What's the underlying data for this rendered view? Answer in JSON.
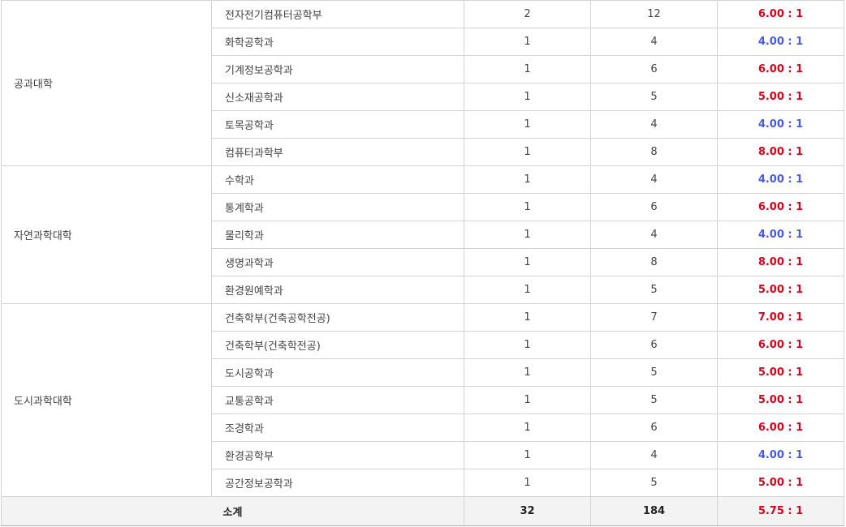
{
  "colors": {
    "ratio_high": "#e0001b",
    "ratio_low": "#4758e8",
    "border": "#d4d4d4",
    "total_bg": "#f3f3f3"
  },
  "groups": [
    {
      "college": "공과대학",
      "rows": [
        {
          "dept": "전자전기컴퓨터공학부",
          "quota": "2",
          "applicants": "12",
          "ratio": "6.00 : 1",
          "tone": "red"
        },
        {
          "dept": "화학공학과",
          "quota": "1",
          "applicants": "4",
          "ratio": "4.00 : 1",
          "tone": "blue"
        },
        {
          "dept": "기계정보공학과",
          "quota": "1",
          "applicants": "6",
          "ratio": "6.00 : 1",
          "tone": "red"
        },
        {
          "dept": "신소재공학과",
          "quota": "1",
          "applicants": "5",
          "ratio": "5.00 : 1",
          "tone": "red"
        },
        {
          "dept": "토목공학과",
          "quota": "1",
          "applicants": "4",
          "ratio": "4.00 : 1",
          "tone": "blue"
        },
        {
          "dept": "컴퓨터과학부",
          "quota": "1",
          "applicants": "8",
          "ratio": "8.00 : 1",
          "tone": "red"
        }
      ]
    },
    {
      "college": "자연과학대학",
      "rows": [
        {
          "dept": "수학과",
          "quota": "1",
          "applicants": "4",
          "ratio": "4.00 : 1",
          "tone": "blue"
        },
        {
          "dept": "통계학과",
          "quota": "1",
          "applicants": "6",
          "ratio": "6.00 : 1",
          "tone": "red"
        },
        {
          "dept": "물리학과",
          "quota": "1",
          "applicants": "4",
          "ratio": "4.00 : 1",
          "tone": "blue"
        },
        {
          "dept": "생명과학과",
          "quota": "1",
          "applicants": "8",
          "ratio": "8.00 : 1",
          "tone": "red"
        },
        {
          "dept": "환경원예학과",
          "quota": "1",
          "applicants": "5",
          "ratio": "5.00 : 1",
          "tone": "red"
        }
      ]
    },
    {
      "college": "도시과학대학",
      "rows": [
        {
          "dept": "건축학부(건축공학전공)",
          "quota": "1",
          "applicants": "7",
          "ratio": "7.00 : 1",
          "tone": "red"
        },
        {
          "dept": "건축학부(건축학전공)",
          "quota": "1",
          "applicants": "6",
          "ratio": "6.00 : 1",
          "tone": "red"
        },
        {
          "dept": "도시공학과",
          "quota": "1",
          "applicants": "5",
          "ratio": "5.00 : 1",
          "tone": "red"
        },
        {
          "dept": "교통공학과",
          "quota": "1",
          "applicants": "5",
          "ratio": "5.00 : 1",
          "tone": "red"
        },
        {
          "dept": "조경학과",
          "quota": "1",
          "applicants": "6",
          "ratio": "6.00 : 1",
          "tone": "red"
        },
        {
          "dept": "환경공학부",
          "quota": "1",
          "applicants": "4",
          "ratio": "4.00 : 1",
          "tone": "blue"
        },
        {
          "dept": "공간정보공학과",
          "quota": "1",
          "applicants": "5",
          "ratio": "5.00 : 1",
          "tone": "red"
        }
      ]
    }
  ],
  "total": {
    "label": "소계",
    "quota": "32",
    "applicants": "184",
    "ratio": "5.75 : 1"
  }
}
